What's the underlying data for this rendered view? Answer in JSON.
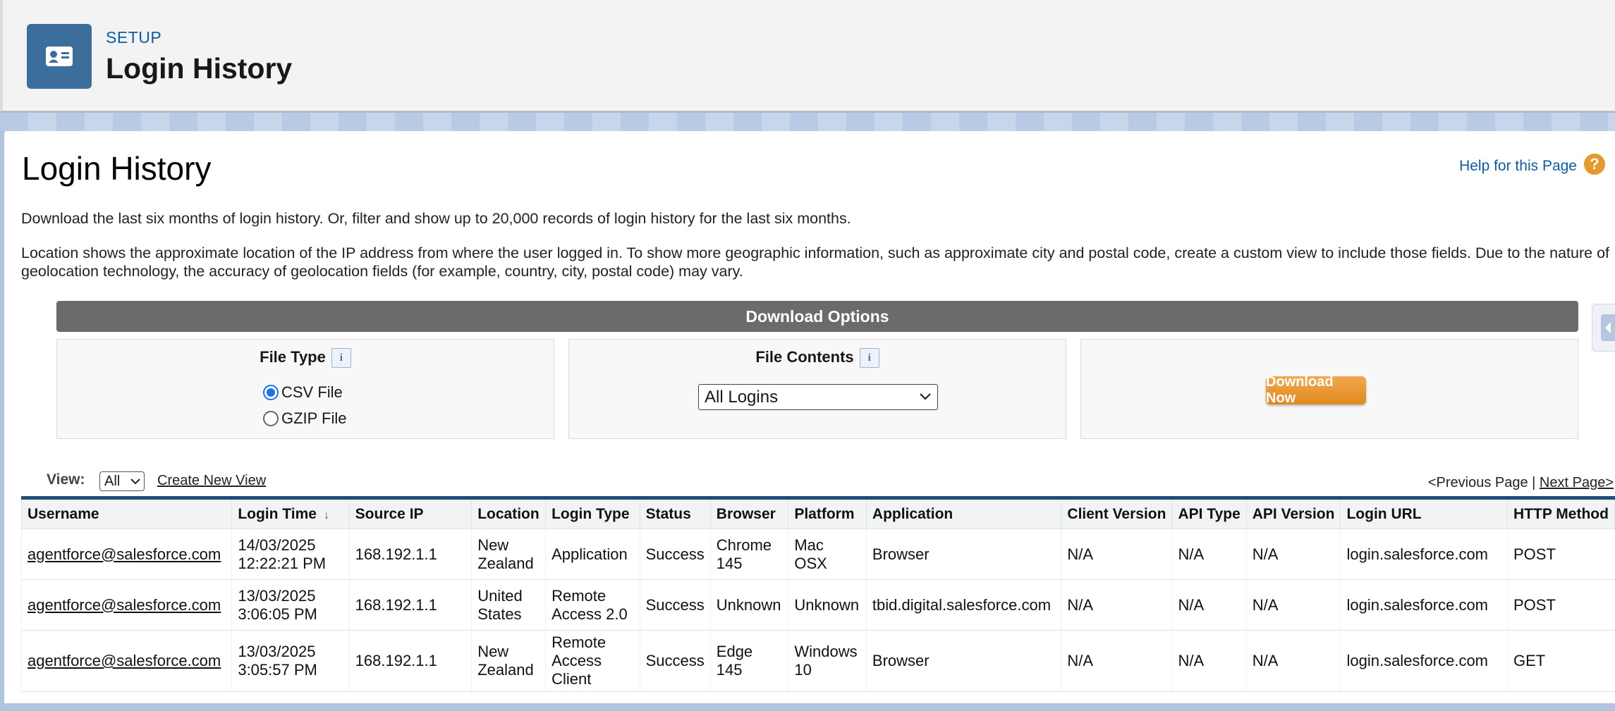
{
  "header": {
    "eyebrow": "SETUP",
    "title": "Login History",
    "icon": "contact-card-icon"
  },
  "page": {
    "title": "Login History",
    "help_link": "Help for this Page",
    "help_icon": "?",
    "description_1": "Download the last six months of login history. Or, filter and show up to 20,000 records of login history for the last six months.",
    "description_2": "Location shows the approximate location of the IP address from where the user logged in. To show more geographic information, such as approximate city and postal code, create a custom view to include those fields. Due to the nature of geolocation technology, the accuracy of geolocation fields (for example, country, city, postal code) may vary."
  },
  "download": {
    "bar_title": "Download Options",
    "file_type_label": "File Type",
    "file_contents_label": "File Contents",
    "info_glyph": "i",
    "options": [
      "CSV File",
      "GZIP File"
    ],
    "selected_option": "CSV File",
    "contents_value": "All Logins",
    "download_button": "Download Now",
    "accent": "#e59a29"
  },
  "view": {
    "label": "View:",
    "selected": "All",
    "create_link": "Create New View",
    "prev": "<Previous Page",
    "separator": " | ",
    "next": "Next Page>"
  },
  "table": {
    "columns": [
      "Username",
      "Login Time",
      "Source IP",
      "Location",
      "Login Type",
      "Status",
      "Browser",
      "Platform",
      "Application",
      "Client Version",
      "API Type",
      "API Version",
      "Login URL",
      "HTTP Method"
    ],
    "sort_indicator": "↓",
    "rows": [
      {
        "username": "agentforce@salesforce.com",
        "date": "14/03/2025",
        "time": "12:22:21 PM",
        "ip": "168.192.1.1",
        "location_1": "New",
        "location_2": "Zealand",
        "type_1": "Application",
        "type_2": "",
        "type_3": "",
        "status": "Success",
        "browser_1": "Chrome",
        "browser_2": "145",
        "platform_1": "Mac",
        "platform_2": "OSX",
        "application": "Browser",
        "client_version": "N/A",
        "api_type": "N/A",
        "api_version": "N/A",
        "login_url": "login.salesforce.com",
        "http_method": "POST"
      },
      {
        "username": "agentforce@salesforce.com",
        "date": "13/03/2025",
        "time": "3:06:05 PM",
        "ip": "168.192.1.1",
        "location_1": "United",
        "location_2": "States",
        "type_1": "Remote",
        "type_2": "Access 2.0",
        "type_3": "",
        "status": "Success",
        "browser_1": "Unknown",
        "browser_2": "",
        "platform_1": "Unknown",
        "platform_2": "",
        "application": "tbid.digital.salesforce.com",
        "client_version": "N/A",
        "api_type": "N/A",
        "api_version": "N/A",
        "login_url": "login.salesforce.com",
        "http_method": "POST"
      },
      {
        "username": "agentforce@salesforce.com",
        "date": "13/03/2025",
        "time": "3:05:57 PM",
        "ip": "168.192.1.1",
        "location_1": "New",
        "location_2": "Zealand",
        "type_1": "Remote",
        "type_2": "Access",
        "type_3": "Client",
        "status": "Success",
        "browser_1": "Edge",
        "browser_2": "145",
        "platform_1": "Windows",
        "platform_2": "10",
        "application": "Browser",
        "client_version": "N/A",
        "api_type": "N/A",
        "api_version": "N/A",
        "login_url": "login.salesforce.com",
        "http_method": "GET"
      }
    ]
  }
}
